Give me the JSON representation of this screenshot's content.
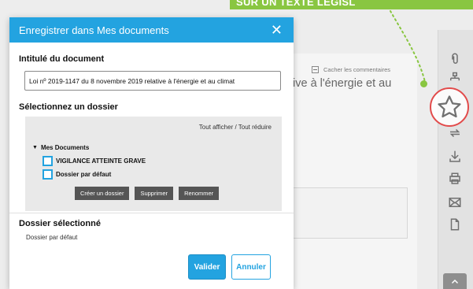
{
  "background": {
    "banner_text": "SUR UN TEXTE LÉGISL",
    "hide_comments_label": "Cacher les commentaires",
    "title_fragment": "ive à l'énergie et au",
    "toolbar_icons": [
      "paperclip-icon",
      "org-chart-icon",
      "star-icon",
      "download-icon",
      "print-icon",
      "mail-icon",
      "document-icon",
      "chevron-up-icon"
    ]
  },
  "modal": {
    "title": "Enregistrer dans Mes documents",
    "close_symbol": "✕",
    "doc_title_label": "Intitulé du document",
    "doc_title_value": "Loi nº 2019-1147 du 8 novembre 2019 relative à l'énergie et au climat",
    "select_folder_label": "Sélectionnez un dossier",
    "tree_actions": "Tout afficher / Tout réduire",
    "tree": {
      "root_label": "Mes Documents",
      "folders": [
        {
          "label": "VIGILANCE ATTEINTE GRAVE",
          "checked": false
        },
        {
          "label": "Dossier par défaut",
          "checked": false
        }
      ]
    },
    "panel_buttons": {
      "create": "Créer un dossier",
      "delete": "Supprimer",
      "rename": "Renommer"
    },
    "selected_folder_label": "Dossier sélectionné",
    "selected_folder_value": "Dossier par défaut",
    "buttons": {
      "validate": "Valider",
      "cancel": "Annuler"
    }
  },
  "colors": {
    "primary": "#23a3e0",
    "banner_green": "#89c641",
    "highlight_red": "#e24b4b",
    "panel_gray": "#e9e9e9",
    "dark_button": "#555555"
  }
}
